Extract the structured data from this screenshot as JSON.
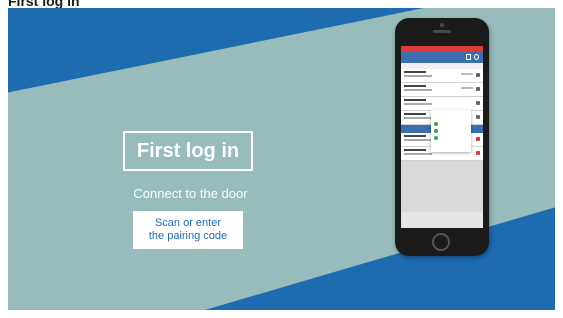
{
  "caption": {
    "text": "First log in"
  },
  "slide": {
    "title": "First log in",
    "subtitle": "Connect to the door",
    "pairing": {
      "line1": "Scan or enter",
      "line2": "the pairing code"
    }
  },
  "colors": {
    "brand_blue": "#1e6bb0",
    "background_teal": "#8fb7b6",
    "success_green": "#3aa54a",
    "app_blue": "#3c6fb0"
  },
  "phone": {
    "dialog_icons": [
      "check-icon",
      "check-icon",
      "check-icon"
    ]
  }
}
